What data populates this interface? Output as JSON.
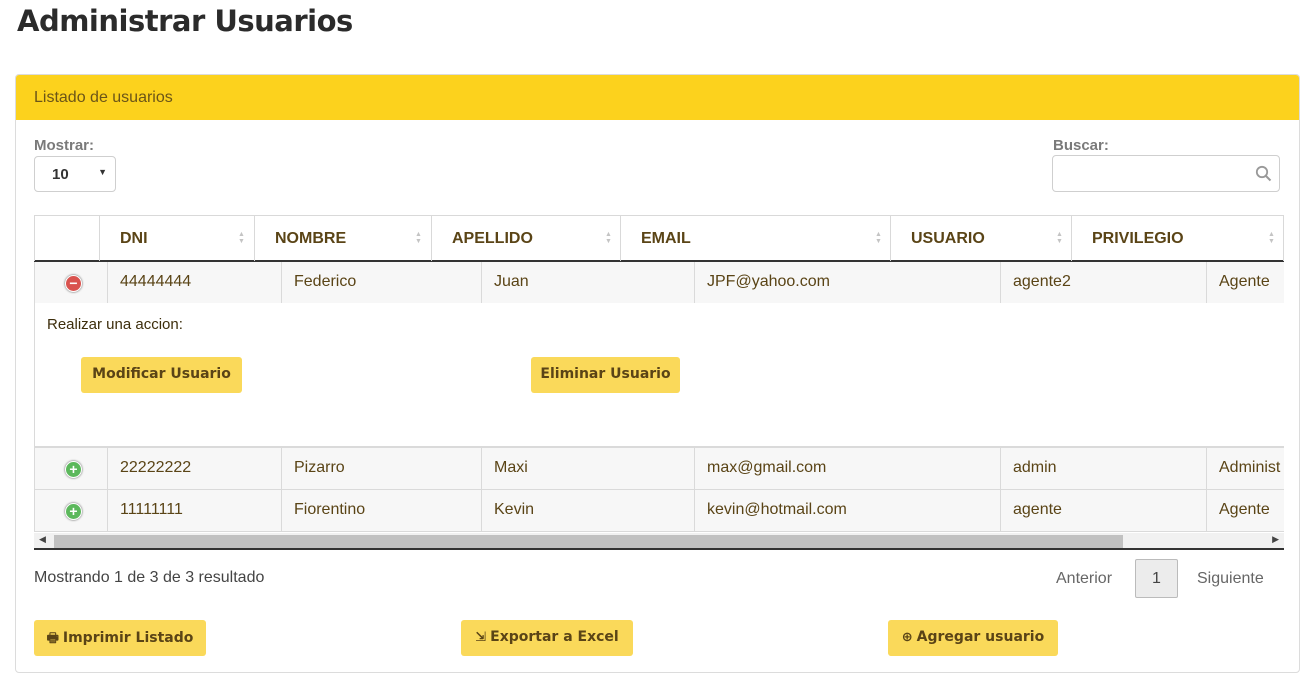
{
  "page": {
    "title": "Administrar Usuarios"
  },
  "panel": {
    "heading": "Listado de usuarios"
  },
  "controls": {
    "show_label": "Mostrar:",
    "show_value": "10",
    "search_label": "Buscar:",
    "search_value": ""
  },
  "table": {
    "headers": [
      "DNI",
      "NOMBRE",
      "APELLIDO",
      "EMAIL",
      "USUARIO",
      "PRIVILEGIO"
    ],
    "rows": [
      {
        "dni": "44444444",
        "nombre": "Federico",
        "apellido": "Juan",
        "email": "JPF@yahoo.com",
        "usuario": "agente2",
        "privilegio": "Agente",
        "expanded": true
      },
      {
        "dni": "22222222",
        "nombre": "Pizarro",
        "apellido": "Maxi",
        "email": "max@gmail.com",
        "usuario": "admin",
        "privilegio": "Administ",
        "expanded": false
      },
      {
        "dni": "11111111",
        "nombre": "Fiorentino",
        "apellido": "Kevin",
        "email": "kevin@hotmail.com",
        "usuario": "agente",
        "privilegio": "Agente",
        "expanded": false
      }
    ],
    "child": {
      "title": "Realizar una accion:",
      "modify_label": "Modificar Usuario",
      "delete_label": "Eliminar Usuario"
    }
  },
  "footer": {
    "info": "Mostrando 1 de 3 de 3 resultado",
    "prev_label": "Anterior",
    "page": "1",
    "next_label": "Siguiente",
    "print_label": "Imprimir Listado",
    "export_label": "Exportar a Excel",
    "add_label": "Agregar usuario"
  },
  "colors": {
    "accent": "#fcd21d",
    "button": "#fad95a",
    "text": "#5a4416",
    "danger": "#d9534f",
    "success": "#5cb85c"
  },
  "icons": {
    "search": "search-icon",
    "collapse": "minus-circle-icon",
    "expand": "plus-circle-icon",
    "print": "printer-icon",
    "export": "export-icon",
    "add": "plus-circle-icon"
  }
}
